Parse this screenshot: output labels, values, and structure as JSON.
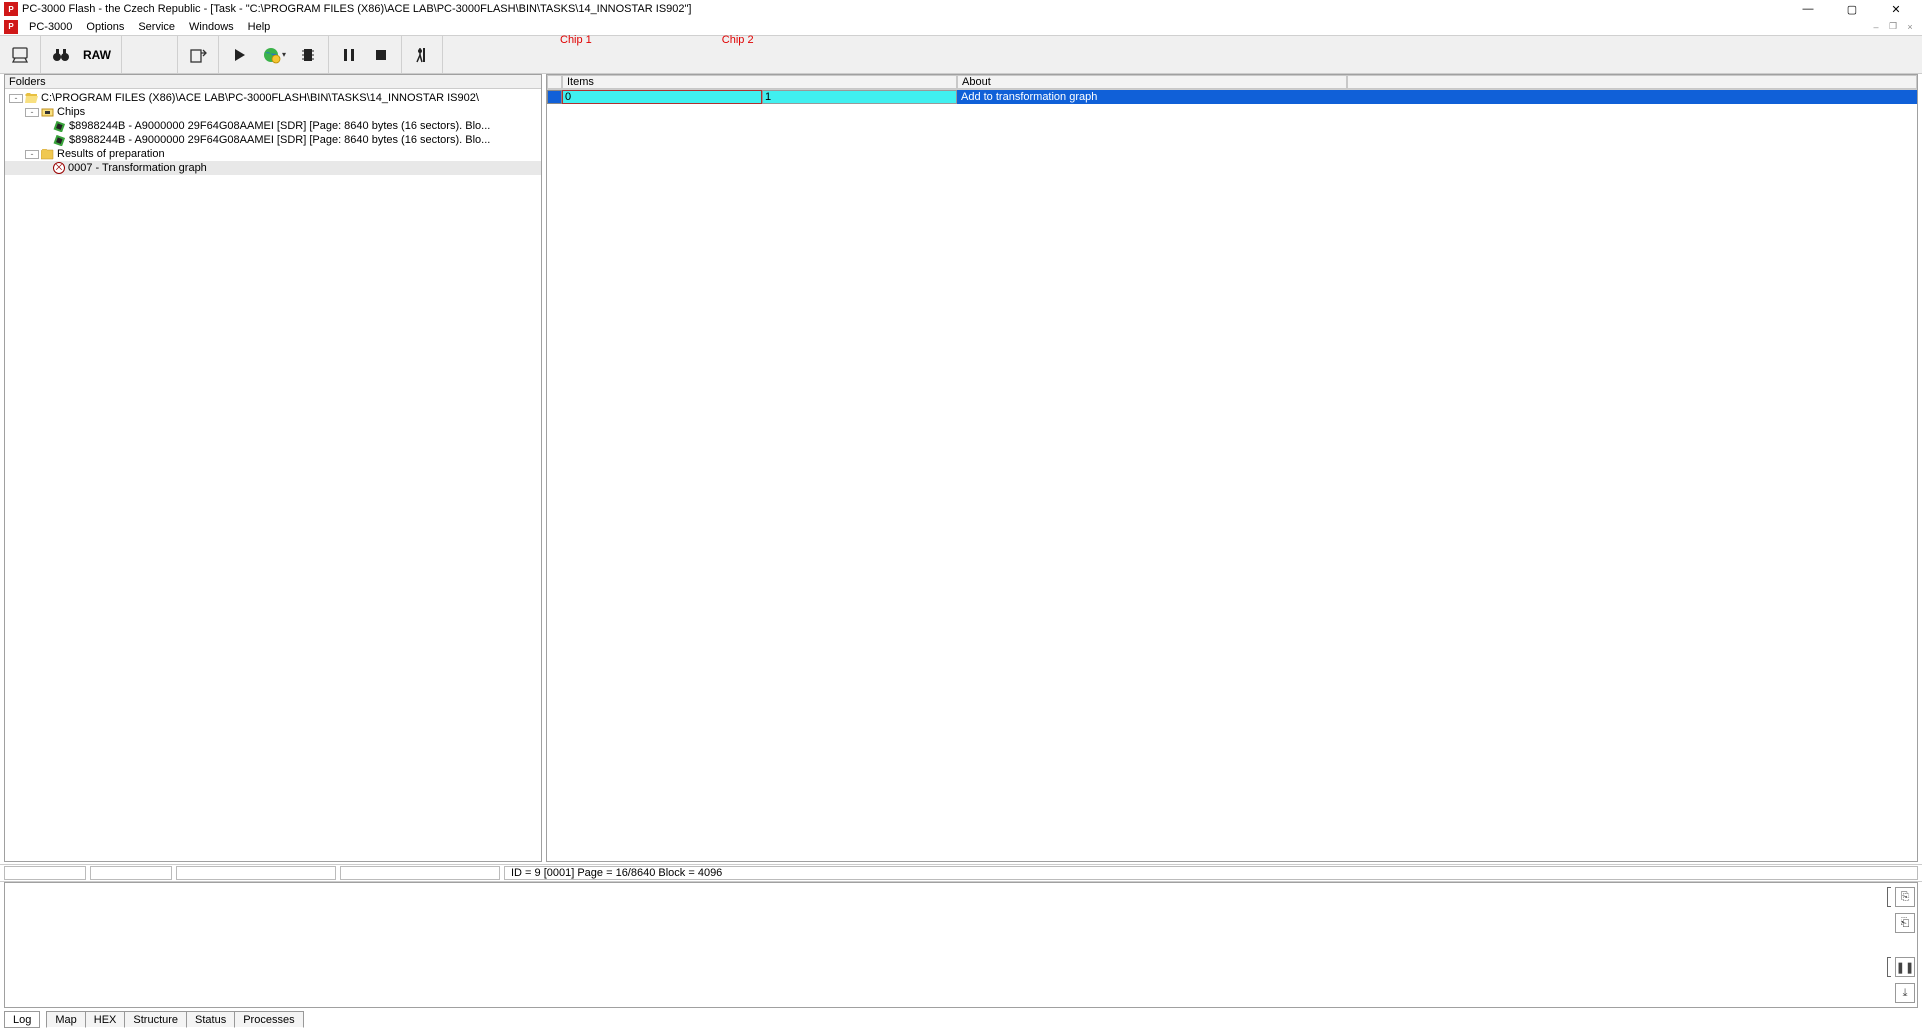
{
  "title": "PC-3000 Flash - the Czech Republic - [Task - \"C:\\PROGRAM FILES (X86)\\ACE LAB\\PC-3000FLASH\\BIN\\TASKS\\14_INNOSTAR IS902\"]",
  "menu": {
    "items": [
      "PC-3000",
      "Options",
      "Service",
      "Windows",
      "Help"
    ]
  },
  "toolbar": {
    "raw_label": "RAW"
  },
  "annotations": {
    "chip1": "Chip 1",
    "chip2": "Chip 2"
  },
  "folders": {
    "header": "Folders",
    "root": "C:\\PROGRAM FILES (X86)\\ACE LAB\\PC-3000FLASH\\BIN\\TASKS\\14_INNOSTAR IS902\\",
    "chips_label": "Chips",
    "chip_rows": [
      "$8988244B  -  A9000000 29F64G08AAMEI [SDR] [Page: 8640 bytes (16 sectors). Blo...",
      "$8988244B  -  A9000000 29F64G08AAMEI [SDR] [Page: 8640 bytes (16 sectors). Blo..."
    ],
    "results_label": "Results of preparation",
    "result_item": "0007 - Transformation graph"
  },
  "grid": {
    "headers": {
      "items": "Items",
      "about": "About"
    },
    "row": {
      "item0": "0",
      "item1": "1",
      "about": "Add to transformation graph"
    }
  },
  "status": {
    "text": "ID = 9 [0001] Page  = 16/8640 Block = 4096"
  },
  "bottom_tabs": [
    "Log",
    "Map",
    "HEX",
    "Structure",
    "Status",
    "Processes"
  ]
}
